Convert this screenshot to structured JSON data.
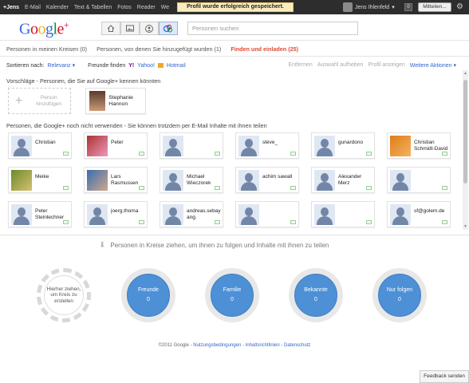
{
  "topbar": {
    "brand": "+Jens",
    "nav": [
      "E-Mail",
      "Kalender",
      "Text & Tabellen",
      "Fotos",
      "Reader",
      "We"
    ],
    "toast": "Profil wurde erfolgreich gespeichert.",
    "user_name": "Jens Ihlenfeld",
    "user_caret": "▾",
    "badge": "0",
    "share_label": "Mitteilen...",
    "gear": "⚙"
  },
  "header": {
    "logo": {
      "g1": "G",
      "g2": "o",
      "g3": "o",
      "g4": "g",
      "g5": "l",
      "g6": "e",
      "plus": "+"
    },
    "nav_icons": [
      "home-icon",
      "photos-icon",
      "profile-icon",
      "circles-icon"
    ],
    "search_placeholder": "Personen suchen"
  },
  "tabs": [
    {
      "label": "Personen in meinen Kreisen (0)",
      "active": false
    },
    {
      "label": "Personen, von denen Sie hinzugefügt wurden (1)",
      "active": false
    },
    {
      "label": "Finden und einladen (25)",
      "active": true
    }
  ],
  "sort": {
    "label": "Sortieren nach:",
    "value": "Relevanz ▾",
    "find_label": "Freunde finden",
    "yahoo_icon": "Y!",
    "yahoo": "Yahoo!",
    "hotmail": "Hotmail"
  },
  "actions": {
    "remove": "Entfernen",
    "deselect": "Auswahl aufheben",
    "show_profile": "Profil anzeigen",
    "more": "Weitere Aktionen ▾"
  },
  "suggestions": {
    "title": "Vorschläge - Personen, die Sie auf Google+ kennen könnten",
    "add_label": "Person hinzufügen",
    "add_icon": "+",
    "person": "Stephanie Hannon"
  },
  "invite": {
    "title": "Personen, die Google+ noch nicht verwenden - Sie können trotzdem per E-Mail Inhalte mit ihnen teilen",
    "contacts": [
      {
        "name": "Christian",
        "pic": "default"
      },
      {
        "name": "Peter",
        "pic": "photo-a"
      },
      {
        "name": "",
        "pic": "default"
      },
      {
        "name": "steve_",
        "pic": "default"
      },
      {
        "name": "gunardono",
        "pic": "default"
      },
      {
        "name": "Christian Schmidt-David",
        "pic": "photo-d"
      },
      {
        "name": "Meike",
        "pic": "photo-b"
      },
      {
        "name": "Lars Rasmussen",
        "pic": "photo-c"
      },
      {
        "name": "Michael Wieczorek",
        "pic": "default"
      },
      {
        "name": "achim sawall",
        "pic": "default"
      },
      {
        "name": "Alexander Merz",
        "pic": "default"
      },
      {
        "name": "",
        "pic": "default"
      },
      {
        "name": "Peter Steinlechner",
        "pic": "default"
      },
      {
        "name": "joerg.thoma",
        "pic": "default"
      },
      {
        "name": "andreas.sebayang.",
        "pic": "default"
      },
      {
        "name": "",
        "pic": "default"
      },
      {
        "name": "",
        "pic": "default"
      },
      {
        "name": "sf@golem.de",
        "pic": "default"
      }
    ]
  },
  "drag_hint": "Personen in Kreise ziehen, um ihnen zu folgen und Inhalte mit ihnen zu teilen",
  "new_circle": "Hierher ziehen, um Kreis zu erstellen",
  "circles": [
    {
      "name": "Freunde",
      "count": "0"
    },
    {
      "name": "Familie",
      "count": "0"
    },
    {
      "name": "Bekannte",
      "count": "0"
    },
    {
      "name": "Nur folgen",
      "count": "0"
    }
  ],
  "footer": {
    "copyright": "©2011 Google - ",
    "terms": "Nutzungsbedingungen",
    "sep1": " - ",
    "guidelines": "Inhaltsrichtlinien",
    "sep2": " - ",
    "privacy": "Datenschutz"
  },
  "feedback": "Feedback senden",
  "colors": {
    "accent": "#dd4b39",
    "circle_blue": "#4d90d6",
    "link": "#3366cc",
    "toast": "#f9edbe"
  }
}
